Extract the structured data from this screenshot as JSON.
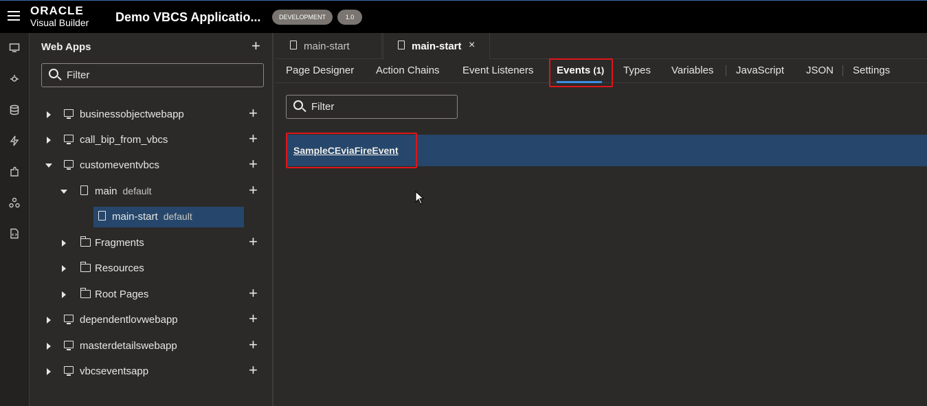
{
  "header": {
    "brand_oracle": "ORACLE",
    "brand_product": "Visual Builder",
    "app_title": "Demo VBCS Applicatio...",
    "env_badge": "DEVELOPMENT",
    "version_badge": "1.0"
  },
  "rail": {
    "icons": [
      "web-apps-icon",
      "services-icon",
      "business-objects-icon",
      "processes-icon",
      "components-icon",
      "source-icon",
      "code-icon"
    ]
  },
  "panel": {
    "title": "Web Apps",
    "filter_placeholder": "Filter",
    "tree": [
      {
        "label": "businessobjectwebapp",
        "sub": ""
      },
      {
        "label": "call_bip_from_vbcs",
        "sub": ""
      },
      {
        "label": "customeventvbcs",
        "sub": ""
      },
      {
        "label": "main",
        "sub": "default"
      },
      {
        "label": "main-start",
        "sub": "default"
      },
      {
        "label": "Fragments",
        "sub": ""
      },
      {
        "label": "Resources",
        "sub": ""
      },
      {
        "label": "Root Pages",
        "sub": ""
      },
      {
        "label": "dependentlovwebapp",
        "sub": ""
      },
      {
        "label": "masterdetailswebapp",
        "sub": ""
      },
      {
        "label": "vbcseventsapp",
        "sub": ""
      }
    ]
  },
  "tabs": [
    {
      "label": "main-start"
    },
    {
      "label": "main-start",
      "close": "×"
    }
  ],
  "subnav": {
    "items": [
      "Page Designer",
      "Action Chains",
      "Event Listeners",
      "Events",
      "Types",
      "Variables",
      "JavaScript",
      "JSON",
      "Settings"
    ],
    "events_count": "(1)"
  },
  "main": {
    "filter_placeholder": "Filter",
    "events": [
      "SampleCEviaFireEvent"
    ]
  },
  "colors": {
    "accent": "#3b8ee8",
    "selection": "#26476b",
    "highlight_box": "#e0151b"
  }
}
